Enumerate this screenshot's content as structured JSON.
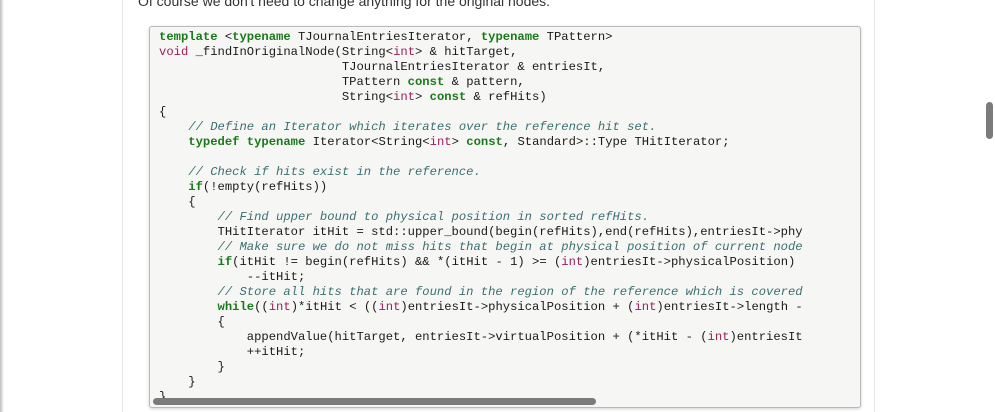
{
  "intro_text": "Of course we don't need to change anything for the original nodes.",
  "code_lines": [
    [
      {
        "c": "kw",
        "t": "template"
      },
      {
        "c": "",
        "t": " <"
      },
      {
        "c": "kw",
        "t": "typename"
      },
      {
        "c": "",
        "t": " TJournalEntriesIterator, "
      },
      {
        "c": "kw",
        "t": "typename"
      },
      {
        "c": "",
        "t": " TPattern>"
      }
    ],
    [
      {
        "c": "ty",
        "t": "void"
      },
      {
        "c": "",
        "t": " _findInOriginalNode(String<"
      },
      {
        "c": "ty",
        "t": "int"
      },
      {
        "c": "",
        "t": "> & hitTarget,"
      }
    ],
    [
      {
        "c": "",
        "t": "                         TJournalEntriesIterator & entriesIt,"
      }
    ],
    [
      {
        "c": "",
        "t": "                         TPattern "
      },
      {
        "c": "kw",
        "t": "const"
      },
      {
        "c": "",
        "t": " & pattern,"
      }
    ],
    [
      {
        "c": "",
        "t": "                         String<"
      },
      {
        "c": "ty",
        "t": "int"
      },
      {
        "c": "",
        "t": "> "
      },
      {
        "c": "kw",
        "t": "const"
      },
      {
        "c": "",
        "t": " & refHits)"
      }
    ],
    [
      {
        "c": "",
        "t": "{"
      }
    ],
    [
      {
        "c": "cm",
        "t": "    // Define an Iterator which iterates over the reference hit set."
      }
    ],
    [
      {
        "c": "",
        "t": "    "
      },
      {
        "c": "kw",
        "t": "typedef"
      },
      {
        "c": "",
        "t": " "
      },
      {
        "c": "kw",
        "t": "typename"
      },
      {
        "c": "",
        "t": " Iterator<String<"
      },
      {
        "c": "ty",
        "t": "int"
      },
      {
        "c": "",
        "t": "> "
      },
      {
        "c": "kw",
        "t": "const"
      },
      {
        "c": "",
        "t": ", Standard>::Type THitIterator;"
      }
    ],
    [
      {
        "c": "",
        "t": ""
      }
    ],
    [
      {
        "c": "cm",
        "t": "    // Check if hits exist in the reference."
      }
    ],
    [
      {
        "c": "",
        "t": "    "
      },
      {
        "c": "kw",
        "t": "if"
      },
      {
        "c": "",
        "t": "(!empty(refHits))"
      }
    ],
    [
      {
        "c": "",
        "t": "    {"
      }
    ],
    [
      {
        "c": "cm",
        "t": "        // Find upper bound to physical position in sorted refHits."
      }
    ],
    [
      {
        "c": "",
        "t": "        THitIterator itHit = std::upper_bound(begin(refHits),end(refHits),entriesIt->phy"
      }
    ],
    [
      {
        "c": "cm",
        "t": "        // Make sure we do not miss hits that begin at physical position of current node"
      }
    ],
    [
      {
        "c": "",
        "t": "        "
      },
      {
        "c": "kw",
        "t": "if"
      },
      {
        "c": "",
        "t": "(itHit != begin(refHits) && *(itHit - 1) >= ("
      },
      {
        "c": "ty",
        "t": "int"
      },
      {
        "c": "",
        "t": ")entriesIt->physicalPosition)"
      }
    ],
    [
      {
        "c": "",
        "t": "            --itHit;"
      }
    ],
    [
      {
        "c": "cm",
        "t": "        // Store all hits that are found in the region of the reference which is covered"
      }
    ],
    [
      {
        "c": "",
        "t": "        "
      },
      {
        "c": "kw",
        "t": "while"
      },
      {
        "c": "",
        "t": "(("
      },
      {
        "c": "ty",
        "t": "int"
      },
      {
        "c": "",
        "t": ")*itHit < (("
      },
      {
        "c": "ty",
        "t": "int"
      },
      {
        "c": "",
        "t": ")entriesIt->physicalPosition + ("
      },
      {
        "c": "ty",
        "t": "int"
      },
      {
        "c": "",
        "t": ")entriesIt->length -"
      }
    ],
    [
      {
        "c": "",
        "t": "        {"
      }
    ],
    [
      {
        "c": "",
        "t": "            appendValue(hitTarget, entriesIt->virtualPosition + (*itHit - ("
      },
      {
        "c": "ty",
        "t": "int"
      },
      {
        "c": "",
        "t": ")entriesIt"
      }
    ],
    [
      {
        "c": "",
        "t": "            ++itHit;"
      }
    ],
    [
      {
        "c": "",
        "t": "        }"
      }
    ],
    [
      {
        "c": "",
        "t": "    }"
      }
    ],
    [
      {
        "c": "",
        "t": "}"
      }
    ]
  ]
}
